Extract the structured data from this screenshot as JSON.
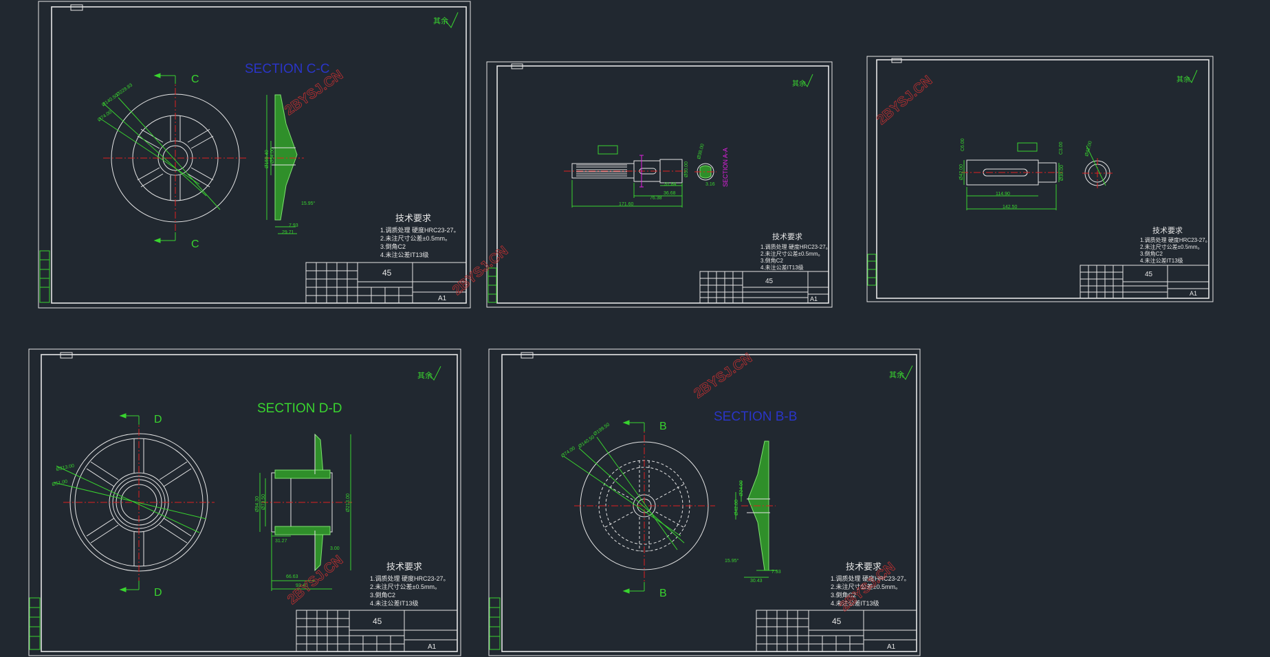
{
  "colors": {
    "background": "#212830",
    "lines": "#e6e6e6",
    "dimensions": "#39d42f",
    "centerlines": "#e02020",
    "section_blue": "#2a35c8",
    "section_green": "#39d42f",
    "section_magenta": "#e020e0",
    "watermark": "#c03030"
  },
  "watermark": "2BYSJ.CN",
  "sheet1": {
    "title": "SECTION C-C",
    "mark_top": "C",
    "mark_bottom": "C",
    "dims": {
      "d1": "Ø229.83",
      "d2": "Ø140.50",
      "d3": "Ø74.00",
      "v1": "Ø159.40",
      "v2": "Ø54.00",
      "angle": "15.95°",
      "w1": "7.93",
      "w2": "29.71"
    },
    "req_title": "技术要求",
    "req": [
      "1.调质处理 硬度HRC23-27。",
      "2.未注尺寸公差±0.5mm。",
      "3.倒角C2",
      "4.未注公差IT13级"
    ],
    "material": "45",
    "scale": "A1",
    "roughness": "其余"
  },
  "sheet2": {
    "section_label": "SECTION A-A",
    "dims": {
      "d1": "Ø38.00",
      "d2": "Ø50.00",
      "l1": "31.84",
      "l2": "36.68",
      "l3": "76.38",
      "l4": "171.60",
      "k": "3.16"
    },
    "req_title": "技术要求",
    "req": [
      "1.调质处理 硬度HRC23-27。",
      "2.未注尺寸公差±0.5mm。",
      "3.倒角C2",
      "4.未注公差IT13级"
    ],
    "material": "45",
    "scale": "A1",
    "roughness": "其余"
  },
  "sheet3": {
    "dims": {
      "c1": "C6.00",
      "c2": "C3.00",
      "d1": "Ø42.00",
      "d2": "Ø30.00",
      "l1": "114.90",
      "l2": "142.50",
      "dr": "Ø42.00"
    },
    "req_title": "技术要求",
    "req": [
      "1.调质处理 硬度HRC23-27。",
      "2.未注尺寸公差±0.5mm。",
      "3.倒角C2",
      "4.未注公差IT13级"
    ],
    "material": "45",
    "scale": "A1",
    "roughness": "其余"
  },
  "sheet4": {
    "title": "SECTION D-D",
    "mark_top": "D",
    "mark_bottom": "D",
    "dims": {
      "d1": "Ø213.00",
      "d2": "Ø51.00",
      "v1": "Ø94.30",
      "v2": "Ø73.50",
      "v3": "Ø213.00",
      "l1": "31.27",
      "l2": "66.63",
      "l3": "93.40",
      "t": "3.00"
    },
    "req_title": "技术要求",
    "req": [
      "1.调质处理 硬度HRC23-27。",
      "2.未注尺寸公差±0.5mm。",
      "3.倒角C2",
      "4.未注公差IT13级"
    ],
    "material": "45",
    "scale": "A1",
    "roughness": "其余"
  },
  "sheet5": {
    "title": "SECTION B-B",
    "mark_top": "B",
    "mark_bottom": "B",
    "dims": {
      "d1": "Ø199.50",
      "d2": "Ø140.50",
      "d3": "Ø74.00",
      "v1": "Ø42.00",
      "v2": "Ø24.00",
      "angle": "15.95°",
      "w1": "30.43",
      "w2": "7.93"
    },
    "req_title": "技术要求",
    "req": [
      "1.调质处理 硬度HRC23-27。",
      "2.未注尺寸公差±0.5mm。",
      "3.倒角C2",
      "4.未注公差IT13级"
    ],
    "material": "45",
    "scale": "A1",
    "roughness": "其余"
  }
}
